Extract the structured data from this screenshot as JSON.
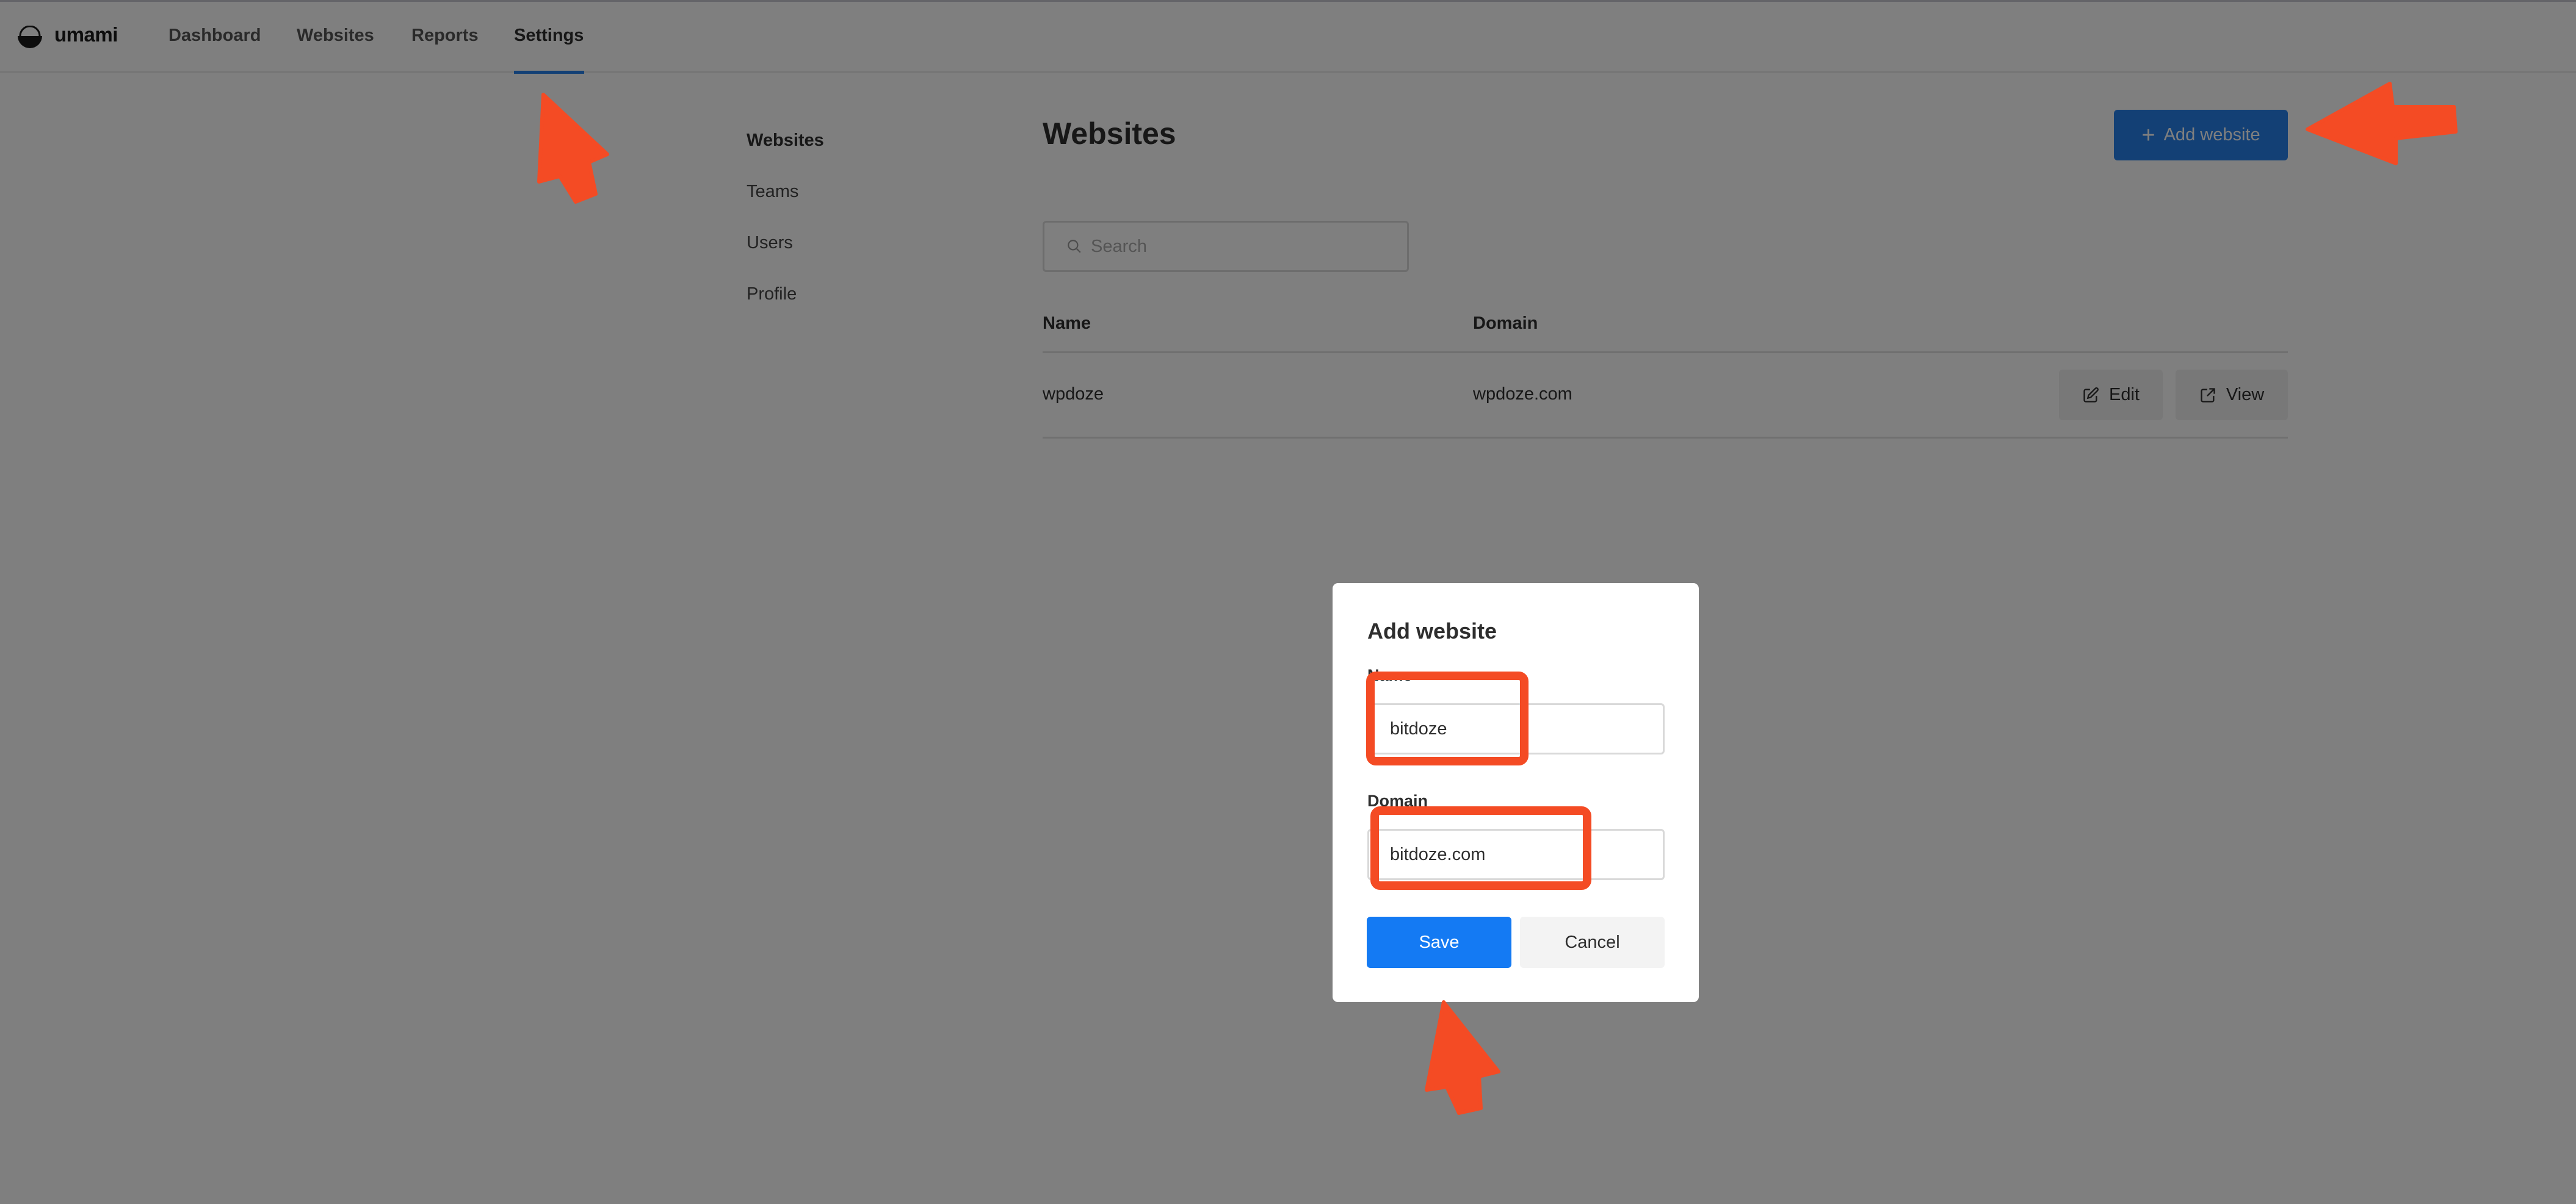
{
  "app": {
    "brand": "umami",
    "nav": [
      {
        "label": "Dashboard",
        "active": false
      },
      {
        "label": "Websites",
        "active": false
      },
      {
        "label": "Reports",
        "active": false
      },
      {
        "label": "Settings",
        "active": true
      }
    ]
  },
  "sidebar": {
    "items": [
      {
        "label": "Websites",
        "active": true
      },
      {
        "label": "Teams",
        "active": false
      },
      {
        "label": "Users",
        "active": false
      },
      {
        "label": "Profile",
        "active": false
      }
    ]
  },
  "main": {
    "title": "Websites",
    "add_button": {
      "icon": "plus-icon",
      "label": "Add website"
    },
    "search": {
      "icon": "search-icon",
      "placeholder": "Search",
      "value": ""
    },
    "table": {
      "columns": [
        "Name",
        "Domain"
      ],
      "rows": [
        {
          "name": "wpdoze",
          "domain": "wpdoze.com",
          "actions": [
            {
              "icon": "edit-icon",
              "label": "Edit"
            },
            {
              "icon": "external-link-icon",
              "label": "View"
            }
          ]
        }
      ]
    }
  },
  "modal": {
    "title": "Add website",
    "fields": [
      {
        "label": "Name",
        "value": "bitdoze"
      },
      {
        "label": "Domain",
        "value": "bitdoze.com"
      }
    ],
    "save_label": "Save",
    "cancel_label": "Cancel"
  },
  "annotations": {
    "color": "#f44b24",
    "arrows": [
      "pointer-to-settings-tab",
      "pointer-to-add-website-button",
      "pointer-to-save-button"
    ],
    "highlight_boxes": [
      "name-field",
      "domain-field"
    ]
  },
  "colors": {
    "accent": "#2680eb",
    "primary_button": "#147af3",
    "annotation": "#f44b24"
  }
}
